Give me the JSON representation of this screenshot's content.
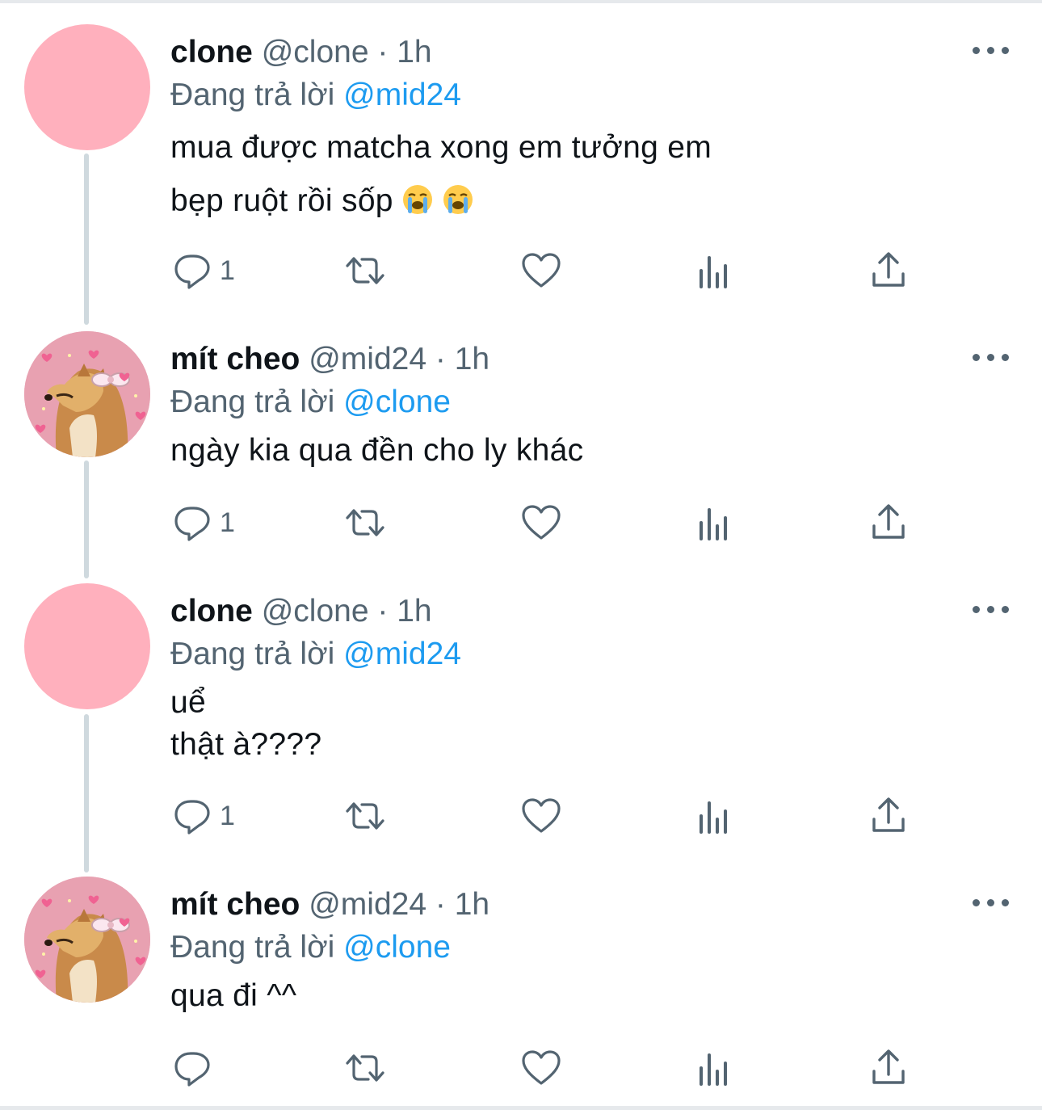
{
  "reply_prefix": "Đang trả lời",
  "tweets": [
    {
      "display_name": "clone",
      "handle": "@clone",
      "dot": "·",
      "time": "1h",
      "reply_to": "@mid24",
      "lines": [
        "mua được matcha xong em tưởng em",
        "bẹp ruột rồi sốp"
      ],
      "emojis": [
        "loudly-crying-face",
        "loudly-crying-face"
      ],
      "reply_count": "1",
      "avatar": "pink-circle"
    },
    {
      "display_name": "mít cheo",
      "handle": "@mid24",
      "dot": "·",
      "time": "1h",
      "reply_to": "@clone",
      "lines": [
        "ngày kia qua đền cho ly khác"
      ],
      "reply_count": "1",
      "avatar": "shiba-dog-with-bow"
    },
    {
      "display_name": "clone",
      "handle": "@clone",
      "dot": "·",
      "time": "1h",
      "reply_to": "@mid24",
      "lines": [
        "uể",
        "thật à????"
      ],
      "reply_count": "1",
      "avatar": "pink-circle"
    },
    {
      "display_name": "mít cheo",
      "handle": "@mid24",
      "dot": "·",
      "time": "1h",
      "reply_to": "@clone",
      "lines": [
        "qua đi ^^"
      ],
      "reply_count": "",
      "avatar": "shiba-dog-with-bow"
    }
  ],
  "icons": {
    "reply": "reply-icon",
    "retweet": "retweet-icon",
    "like": "like-icon",
    "views": "views-icon",
    "share": "share-icon",
    "more": "more-icon"
  },
  "colors": {
    "mention": "#1d9bf0",
    "secondary_text": "#536471",
    "pink_avatar": "#ffb0bd",
    "thread_line": "#cfd9de"
  }
}
